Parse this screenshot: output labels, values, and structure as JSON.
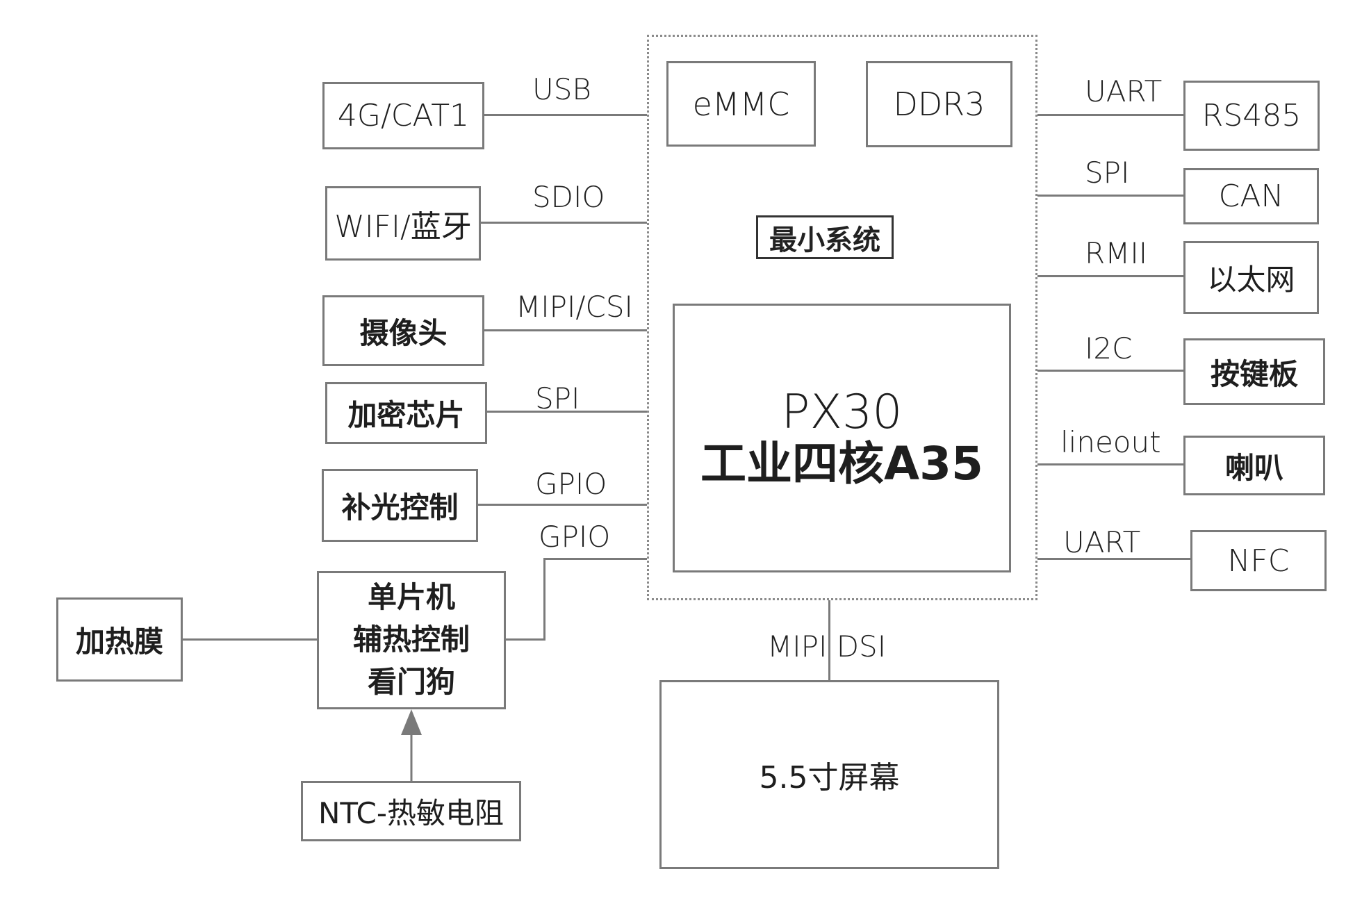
{
  "core": {
    "group_label": "最小系统",
    "memory": [
      {
        "id": "emmc",
        "label": "eMMC"
      },
      {
        "id": "ddr3",
        "label": "DDR3"
      }
    ],
    "cpu": {
      "line1": "PX30",
      "line2": "工业四核A35"
    }
  },
  "left_peripherals": [
    {
      "id": "4g",
      "label": "4G/CAT1",
      "interface": "USB"
    },
    {
      "id": "wifi",
      "label": "WIFI/蓝牙",
      "interface": "SDIO"
    },
    {
      "id": "camera",
      "label": "摄像头",
      "interface": "MIPI/CSI"
    },
    {
      "id": "crypto",
      "label": "加密芯片",
      "interface": "SPI"
    },
    {
      "id": "fill-light",
      "label": "补光控制",
      "interface": "GPIO"
    }
  ],
  "mcu": {
    "lines": [
      "单片机",
      "辅热控制",
      "看门狗"
    ],
    "interface": "GPIO",
    "heater": {
      "label": "加热膜"
    },
    "sensor": {
      "label": "NTC-热敏电阻"
    }
  },
  "right_peripherals": [
    {
      "id": "rs485",
      "label": "RS485",
      "interface": "UART"
    },
    {
      "id": "can",
      "label": "CAN",
      "interface": "SPI"
    },
    {
      "id": "ethernet",
      "label": "以太网",
      "interface": "RMII"
    },
    {
      "id": "keypad",
      "label": "按键板",
      "interface": "I2C"
    },
    {
      "id": "speaker",
      "label": "喇叭",
      "interface": "lineout"
    },
    {
      "id": "nfc",
      "label": "NFC",
      "interface": "UART"
    }
  ],
  "display": {
    "label": "5.5寸屏幕",
    "interface": "MIPI DSI"
  },
  "colors": {
    "line": "#7a7a7a",
    "text": "#1e1e1e",
    "background": "#ffffff"
  }
}
